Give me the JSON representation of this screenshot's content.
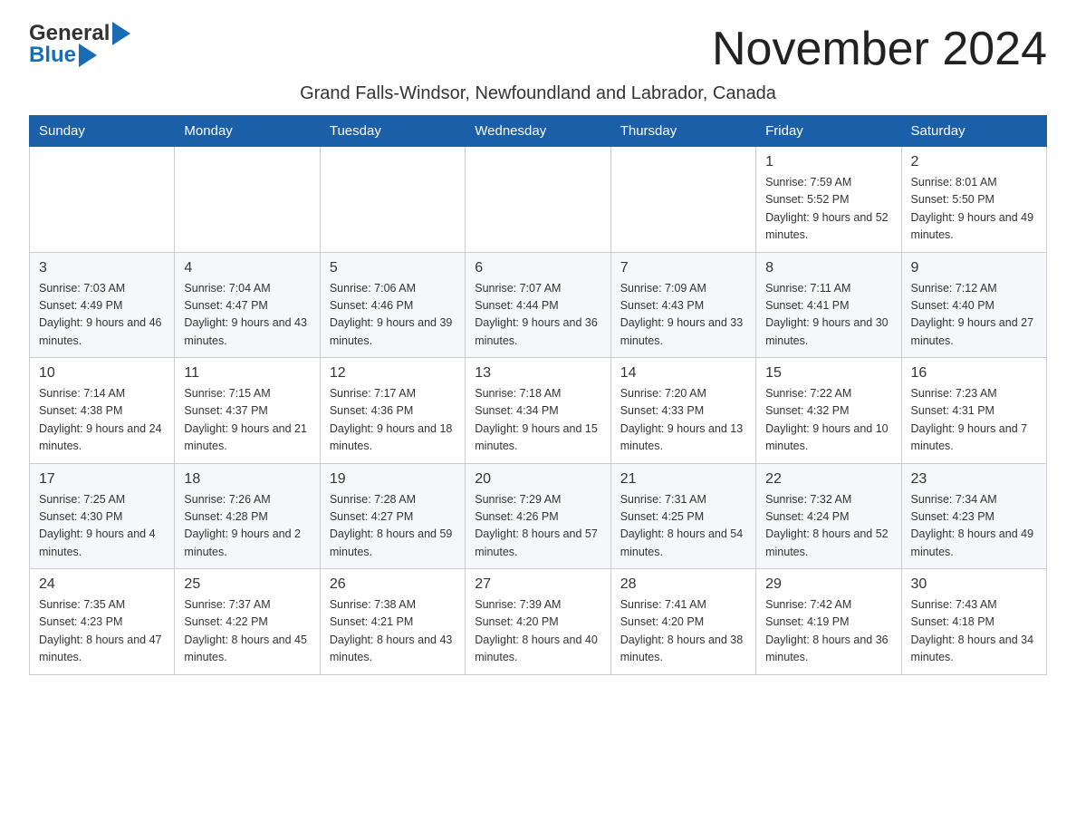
{
  "logo": {
    "general": "General",
    "blue": "Blue"
  },
  "title": "November 2024",
  "subtitle": "Grand Falls-Windsor, Newfoundland and Labrador, Canada",
  "weekdays": [
    "Sunday",
    "Monday",
    "Tuesday",
    "Wednesday",
    "Thursday",
    "Friday",
    "Saturday"
  ],
  "weeks": [
    [
      {
        "day": "",
        "info": ""
      },
      {
        "day": "",
        "info": ""
      },
      {
        "day": "",
        "info": ""
      },
      {
        "day": "",
        "info": ""
      },
      {
        "day": "",
        "info": ""
      },
      {
        "day": "1",
        "info": "Sunrise: 7:59 AM\nSunset: 5:52 PM\nDaylight: 9 hours and 52 minutes."
      },
      {
        "day": "2",
        "info": "Sunrise: 8:01 AM\nSunset: 5:50 PM\nDaylight: 9 hours and 49 minutes."
      }
    ],
    [
      {
        "day": "3",
        "info": "Sunrise: 7:03 AM\nSunset: 4:49 PM\nDaylight: 9 hours and 46 minutes."
      },
      {
        "day": "4",
        "info": "Sunrise: 7:04 AM\nSunset: 4:47 PM\nDaylight: 9 hours and 43 minutes."
      },
      {
        "day": "5",
        "info": "Sunrise: 7:06 AM\nSunset: 4:46 PM\nDaylight: 9 hours and 39 minutes."
      },
      {
        "day": "6",
        "info": "Sunrise: 7:07 AM\nSunset: 4:44 PM\nDaylight: 9 hours and 36 minutes."
      },
      {
        "day": "7",
        "info": "Sunrise: 7:09 AM\nSunset: 4:43 PM\nDaylight: 9 hours and 33 minutes."
      },
      {
        "day": "8",
        "info": "Sunrise: 7:11 AM\nSunset: 4:41 PM\nDaylight: 9 hours and 30 minutes."
      },
      {
        "day": "9",
        "info": "Sunrise: 7:12 AM\nSunset: 4:40 PM\nDaylight: 9 hours and 27 minutes."
      }
    ],
    [
      {
        "day": "10",
        "info": "Sunrise: 7:14 AM\nSunset: 4:38 PM\nDaylight: 9 hours and 24 minutes."
      },
      {
        "day": "11",
        "info": "Sunrise: 7:15 AM\nSunset: 4:37 PM\nDaylight: 9 hours and 21 minutes."
      },
      {
        "day": "12",
        "info": "Sunrise: 7:17 AM\nSunset: 4:36 PM\nDaylight: 9 hours and 18 minutes."
      },
      {
        "day": "13",
        "info": "Sunrise: 7:18 AM\nSunset: 4:34 PM\nDaylight: 9 hours and 15 minutes."
      },
      {
        "day": "14",
        "info": "Sunrise: 7:20 AM\nSunset: 4:33 PM\nDaylight: 9 hours and 13 minutes."
      },
      {
        "day": "15",
        "info": "Sunrise: 7:22 AM\nSunset: 4:32 PM\nDaylight: 9 hours and 10 minutes."
      },
      {
        "day": "16",
        "info": "Sunrise: 7:23 AM\nSunset: 4:31 PM\nDaylight: 9 hours and 7 minutes."
      }
    ],
    [
      {
        "day": "17",
        "info": "Sunrise: 7:25 AM\nSunset: 4:30 PM\nDaylight: 9 hours and 4 minutes."
      },
      {
        "day": "18",
        "info": "Sunrise: 7:26 AM\nSunset: 4:28 PM\nDaylight: 9 hours and 2 minutes."
      },
      {
        "day": "19",
        "info": "Sunrise: 7:28 AM\nSunset: 4:27 PM\nDaylight: 8 hours and 59 minutes."
      },
      {
        "day": "20",
        "info": "Sunrise: 7:29 AM\nSunset: 4:26 PM\nDaylight: 8 hours and 57 minutes."
      },
      {
        "day": "21",
        "info": "Sunrise: 7:31 AM\nSunset: 4:25 PM\nDaylight: 8 hours and 54 minutes."
      },
      {
        "day": "22",
        "info": "Sunrise: 7:32 AM\nSunset: 4:24 PM\nDaylight: 8 hours and 52 minutes."
      },
      {
        "day": "23",
        "info": "Sunrise: 7:34 AM\nSunset: 4:23 PM\nDaylight: 8 hours and 49 minutes."
      }
    ],
    [
      {
        "day": "24",
        "info": "Sunrise: 7:35 AM\nSunset: 4:23 PM\nDaylight: 8 hours and 47 minutes."
      },
      {
        "day": "25",
        "info": "Sunrise: 7:37 AM\nSunset: 4:22 PM\nDaylight: 8 hours and 45 minutes."
      },
      {
        "day": "26",
        "info": "Sunrise: 7:38 AM\nSunset: 4:21 PM\nDaylight: 8 hours and 43 minutes."
      },
      {
        "day": "27",
        "info": "Sunrise: 7:39 AM\nSunset: 4:20 PM\nDaylight: 8 hours and 40 minutes."
      },
      {
        "day": "28",
        "info": "Sunrise: 7:41 AM\nSunset: 4:20 PM\nDaylight: 8 hours and 38 minutes."
      },
      {
        "day": "29",
        "info": "Sunrise: 7:42 AM\nSunset: 4:19 PM\nDaylight: 8 hours and 36 minutes."
      },
      {
        "day": "30",
        "info": "Sunrise: 7:43 AM\nSunset: 4:18 PM\nDaylight: 8 hours and 34 minutes."
      }
    ]
  ]
}
